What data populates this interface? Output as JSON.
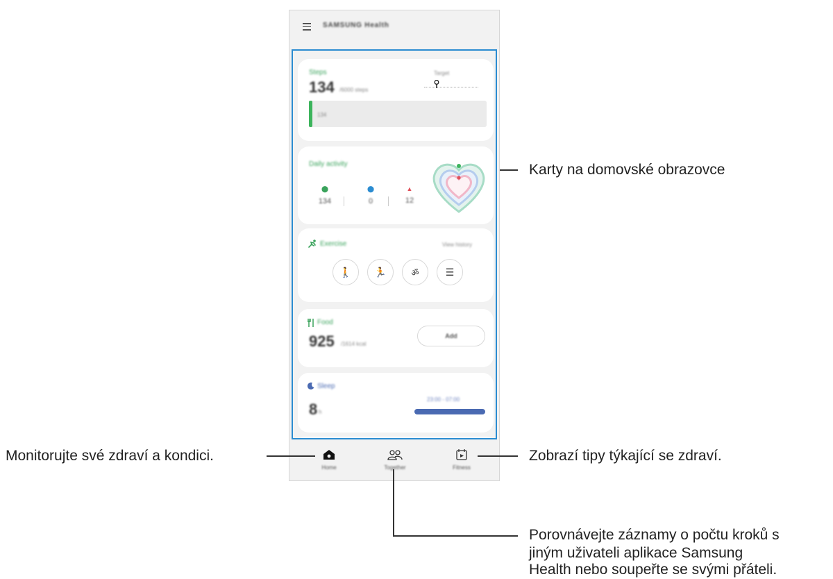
{
  "app": {
    "title": "SAMSUNG Health"
  },
  "cards": {
    "steps": {
      "title": "Steps",
      "value": "134",
      "unit": "/6000 steps",
      "target_label": "Target",
      "bar_label": "134",
      "progress_fraction": 0.02
    },
    "activity": {
      "title": "Daily activity",
      "stats": [
        {
          "value": "134",
          "color": "#3aa35c"
        },
        {
          "value": "0",
          "color": "#2b8cd1"
        },
        {
          "value": "12",
          "color": "#e0505a"
        }
      ]
    },
    "exercise": {
      "title": "Exercise",
      "link": "View history"
    },
    "food": {
      "title": "Food",
      "value": "925",
      "unit": "/1614 kcal",
      "add_label": "Add"
    },
    "sleep": {
      "title": "Sleep",
      "value": "8",
      "unit": "h",
      "time_range": "23:00 - 07:00"
    }
  },
  "nav": {
    "home": "Home",
    "together": "Together",
    "fitness": "Fitness"
  },
  "annotations": {
    "cards": "Karty na domovské obrazovce",
    "home": "Monitorujte své zdraví a kondici.",
    "tips": "Zobrazí tipy týkající se zdraví.",
    "together_line1": "Porovnávejte záznamy o počtu kroků s",
    "together_line2": "jiným uživateli aplikace Samsung",
    "together_line3": "Health nebo soupeřte se svými přáteli."
  },
  "colors": {
    "accent_green": "#3aa35c",
    "highlight_blue": "#2b8cd1",
    "sleep_bar": "#4a6ab2"
  },
  "icons": [
    "menu-icon",
    "target-pin-icon",
    "walking-icon",
    "running-icon",
    "cycling-icon",
    "list-icon",
    "fork-knife-icon",
    "moon-icon",
    "home-icon",
    "together-icon",
    "fitness-icon"
  ]
}
